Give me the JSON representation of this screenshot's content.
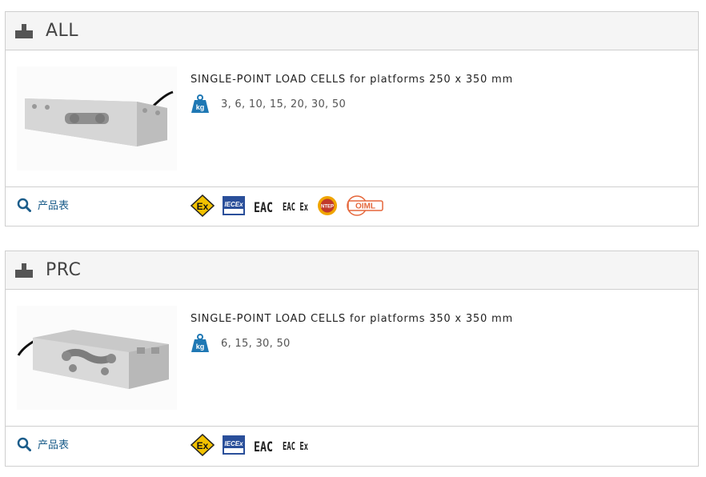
{
  "products": [
    {
      "title": "ALL",
      "description": "SINGLE-POINT LOAD CELLS for platforms 250 x 350 mm",
      "capacities": "3, 6, 10, 15, 20, 30, 50",
      "datasheet_label": "产品表",
      "kg_icon_text": "kg",
      "certifications": {
        "atex": "Ex",
        "iecex": "IECEx",
        "eac": "EAC",
        "eac_ex": "EAC Ex",
        "ntep": "NTEP",
        "oiml": "OIML"
      }
    },
    {
      "title": "PRC",
      "description": "SINGLE-POINT LOAD CELLS for platforms 350 x 350 mm",
      "capacities": "6, 15, 30, 50",
      "datasheet_label": "产品表",
      "kg_icon_text": "kg",
      "certifications": {
        "atex": "Ex",
        "iecex": "IECEx",
        "eac": "EAC",
        "eac_ex": "EAC Ex"
      }
    }
  ],
  "colors": {
    "link_blue": "#1a5c8a",
    "kg_icon_blue": "#1f78b4",
    "atex_yellow": "#f2c100",
    "iecex_blue": "#2a4f9a",
    "oiml_orange": "#e5673b",
    "ntep_red": "#c0392b"
  },
  "icons": {
    "header_icon": "scale-icon",
    "capacity_icon": "kg-weight-icon",
    "datasheet_icon": "search-icon"
  }
}
